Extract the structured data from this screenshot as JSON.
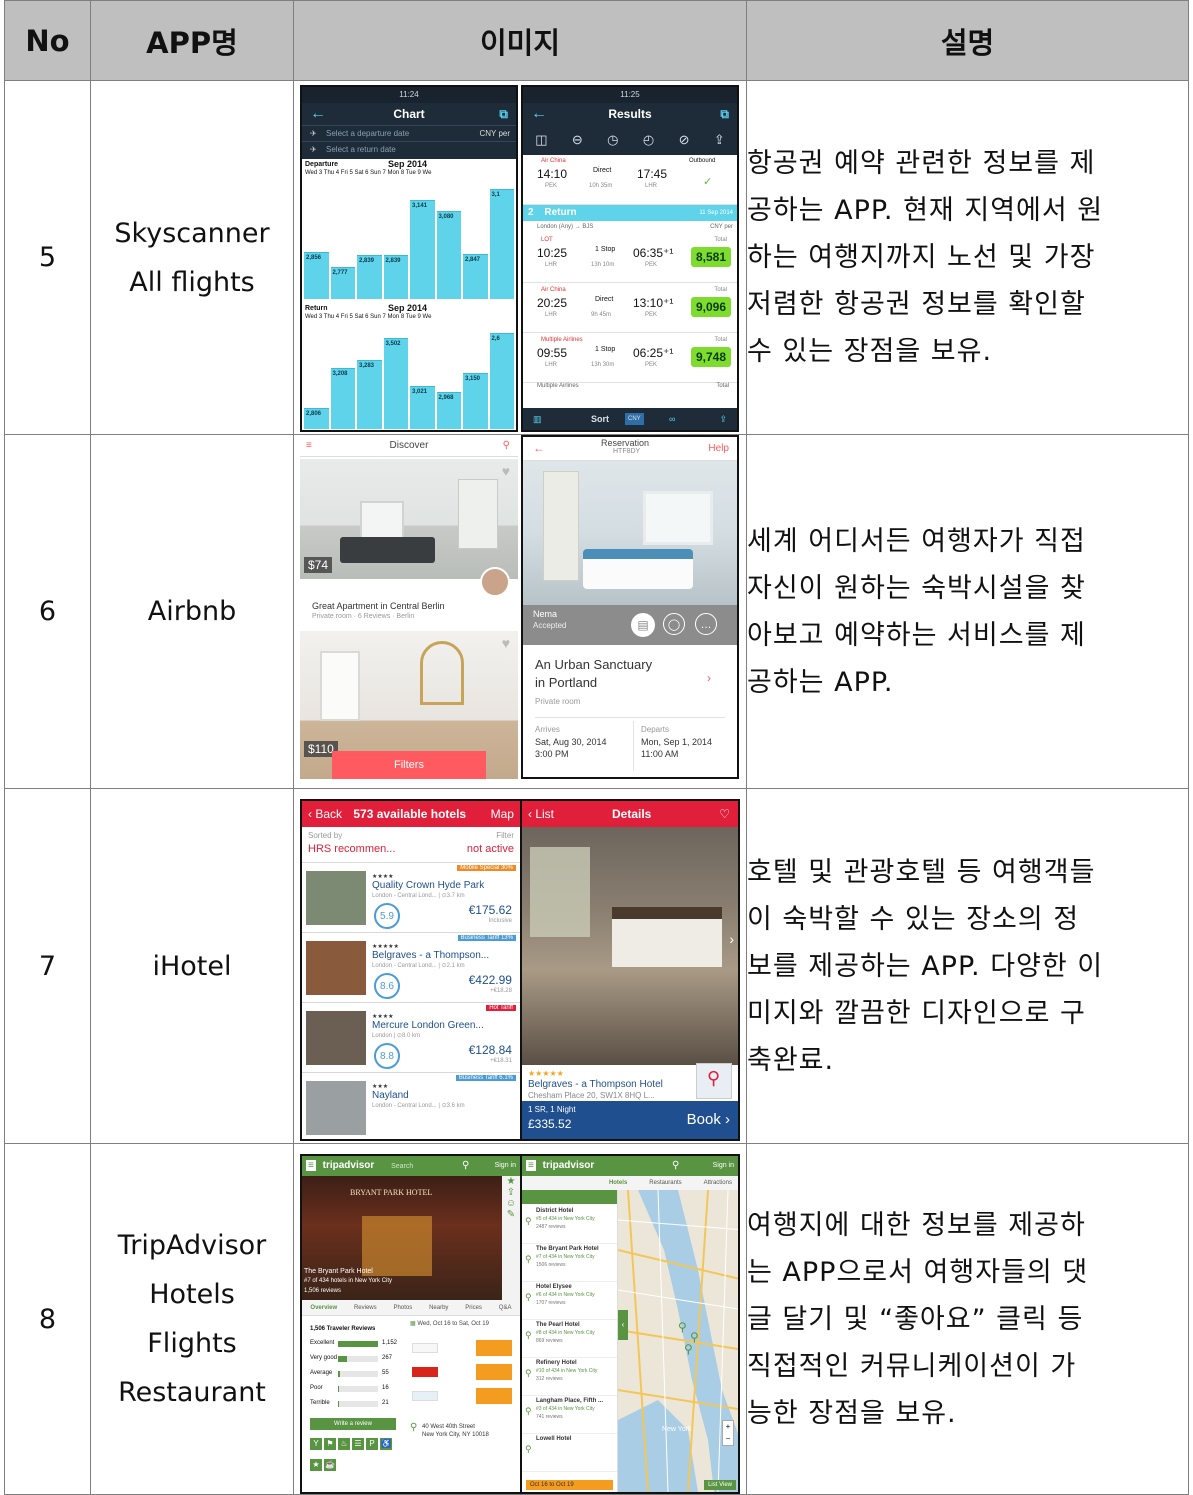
{
  "header": {
    "no": "No",
    "app": "APP명",
    "image": "이미지",
    "desc": "설명"
  },
  "rows": [
    {
      "no": "5",
      "app_lines": [
        "Skyscanner",
        "All flights"
      ],
      "desc_lines": [
        "항공권 예약 관련한 정보를 제",
        "공하는 APP. 현재 지역에서 원",
        "하는 여행지까지 노선 및 가장",
        "저렴한 항공권 정보를 확인할",
        "수 있는 장점을 보유."
      ],
      "left": {
        "status_time": "11:24",
        "title": "Chart",
        "sel1": "Select a departure date",
        "sel2": "Select a return date",
        "currency": "CNY per",
        "departure_label": "Departure",
        "departure_month": "Sep 2014",
        "days": "Wed 3  Thu 4  Fri 5  Sat 6  Sun 7  Mon 8  Tue 9  We",
        "return_label": "Return",
        "return_month": "Sep 2014",
        "bars_top": [
          "2,856",
          "2,777",
          "2,839",
          "2,839",
          "3,141",
          "3,080",
          "2,847",
          "3,1"
        ],
        "bars_bottom": [
          "2,806",
          "3,208",
          "3,283",
          "3,502",
          "3,021",
          "2,968",
          "3,150",
          "2,6"
        ]
      },
      "right": {
        "status_time": "11:25",
        "title": "Results",
        "outbound_airline": "Air China",
        "outbound_dep": "14:10",
        "outbound_dep_code": "PEK",
        "outbound_type": "Direct",
        "outbound_duration": "10h 35m",
        "outbound_arr": "17:45",
        "outbound_arr_code": "LHR",
        "outbound_tag": "Outbound",
        "return_num": "2",
        "return_label": "Return",
        "return_date": "11 Sep 2014",
        "route": "London (Any) → BJS",
        "currency": "CNY per",
        "flights": [
          {
            "airline": "LOT",
            "dep": "10:25",
            "dep_code": "LHR",
            "stops": "1 Stop",
            "dur": "13h 10m",
            "arr": "06:35⁺¹",
            "arr_code": "PEK",
            "total": "Total",
            "price": "8,581"
          },
          {
            "airline": "Air China",
            "dep": "20:25",
            "dep_code": "LHR",
            "stops": "Direct",
            "dur": "9h 45m",
            "arr": "13:10⁺¹",
            "arr_code": "PEK",
            "total": "Total",
            "price": "9,096"
          },
          {
            "airline": "Multiple Airlines",
            "dep": "09:55",
            "dep_code": "LHR",
            "stops": "1 Stop",
            "dur": "13h 30m",
            "arr": "06:25⁺¹",
            "arr_code": "PEK",
            "total": "Total",
            "price": "9,748"
          }
        ],
        "last_airline": "Multiple Airlines",
        "last_total": "Total",
        "sort": "Sort",
        "cny": "CNY"
      }
    },
    {
      "no": "6",
      "app_lines": [
        "Airbnb"
      ],
      "desc_lines": [
        "세계 어디서든 여행자가 직접",
        "자신이 원하는 숙박시설을 찾",
        "아보고 예약하는 서비스를 제",
        "공하는 APP."
      ],
      "left": {
        "title": "Discover",
        "price1": "$74",
        "listing_title": "Great Apartment in Central Berlin",
        "listing_sub": "Private room · 6 Reviews · Berlin",
        "price2": "$110",
        "filters": "Filters"
      },
      "right": {
        "title": "Reservation",
        "code": "HTF8DY",
        "help": "Help",
        "host": "Nema",
        "status": "Accepted",
        "listing_title1": "An Urban Sanctuary",
        "listing_title2": "in Portland",
        "listing_sub": "Private room",
        "arrives_label": "Arrives",
        "arrives_date": "Sat, Aug 30, 2014",
        "arrives_time": "3:00 PM",
        "departs_label": "Departs",
        "departs_date": "Mon, Sep 1, 2014",
        "departs_time": "11:00 AM"
      }
    },
    {
      "no": "7",
      "app_lines": [
        "iHotel"
      ],
      "desc_lines": [
        "호텔 및 관광호텔 등 여행객들",
        "이 숙박할 수 있는 장소의 정",
        "보를 제공하는 APP. 다양한 이",
        "미지와 깔끔한 디자인으로 구",
        "축완료."
      ],
      "left": {
        "back": "Back",
        "count": "573 available hotels",
        "map": "Map",
        "sorted_by": "Sorted by",
        "sort_value": "HRS recommen...",
        "filter": "Filter",
        "filter_value": "not active",
        "hotels": [
          {
            "badge": "Mobile Special 30%",
            "stars": "★★★★",
            "name": "Quality Crown Hyde Park",
            "loc": "London - Central Lond... | ⊙3.7 km",
            "score": "5.9",
            "price": "€175.62",
            "note": "Inclusive"
          },
          {
            "badge": "Business Tariff 13%",
            "stars": "★★★★★",
            "name": "Belgraves - a Thompson...",
            "loc": "London - Central Lond... | ⊙2.1 km",
            "score": "8.6",
            "price": "€422.99",
            "note": "+€18.28"
          },
          {
            "badge": "Hot Tariff",
            "stars": "★★★★",
            "name": "Mercure London Green...",
            "loc": "London | ⊙8.0 km",
            "score": "8.8",
            "price": "€128.84",
            "note": "+€18.31"
          },
          {
            "badge": "Business Tariff 6.1%",
            "stars": "★★★",
            "name": "Nayland",
            "loc": "London - Central Lond... | ⊙3.6 km",
            "score": "",
            "price": "",
            "note": ""
          }
        ]
      },
      "right": {
        "list": "List",
        "title": "Details",
        "stars": "★★★★★",
        "hotel_name": "Belgraves - a Thompson Hotel",
        "address": "Chesham Place 20, SW1X 8HQ L...",
        "night": "1 SR, 1 Night",
        "price": "£335.52",
        "book": "Book ›"
      }
    },
    {
      "no": "8",
      "app_lines": [
        "TripAdvisor",
        "Hotels",
        "Flights",
        "Restaurant"
      ],
      "desc_lines": [
        "여행지에 대한 정보를 제공하",
        "는 APP으로서 여행자들의 댓",
        "글 달기 및 “좋아요” 클릭 등",
        "직접적인 커뮤니케이션이 가",
        "능한 장점을 보유."
      ],
      "left": {
        "brand": "tripadvisor",
        "search": "Search",
        "signin": "Sign in",
        "sign_text": "BRYANT PARK HOTEL",
        "hotel": "The Bryant Park Hotel",
        "rank": "#7 of 434 hotels in New York City",
        "reviews": "1,506 reviews",
        "tabs": [
          "Overview",
          "Reviews",
          "Photos",
          "Nearby",
          "Prices",
          "Q&A"
        ],
        "traveler": "1,506 Traveler Reviews",
        "dates": "Wed, Oct 16 to Sat, Oct 19",
        "ratings": [
          "Excellent",
          "Very good",
          "Average",
          "Poor",
          "Terrible"
        ],
        "counts": [
          "1,152",
          "267",
          "55",
          "16",
          "21"
        ],
        "write": "Write a review",
        "address": "40 West 40th Street",
        "city": "New York City, NY 10018"
      },
      "right": {
        "brand": "tripadvisor",
        "signin": "Sign in",
        "tabs": [
          "Hotels",
          "Restaurants",
          "Attractions"
        ],
        "hotels": [
          {
            "name": "District Hotel",
            "rank": "#5 of 434 in New York City",
            "reviews": "2487 reviews"
          },
          {
            "name": "The Bryant Park Hotel",
            "rank": "#7 of 434 in New York City",
            "reviews": "1506 reviews"
          },
          {
            "name": "Hotel Elysee",
            "rank": "#6 of 434 in New York City",
            "reviews": "1707 reviews"
          },
          {
            "name": "The Pearl Hotel",
            "rank": "#8 of 434 in New York City",
            "reviews": "869 reviews"
          },
          {
            "name": "Refinery Hotel",
            "rank": "#10 of 434 in New York City",
            "reviews": "312 reviews"
          },
          {
            "name": "Langham Place, Fifth ...",
            "rank": "#3 of 434 in New York City",
            "reviews": "741 reviews"
          },
          {
            "name": "Lowell Hotel",
            "rank": "",
            "reviews": ""
          }
        ],
        "city_label": "New York",
        "footer_dates": "Oct 16 to Oct 19",
        "list_view": "List View"
      }
    }
  ],
  "colors": {
    "header_bg": "#bfbfbf",
    "sky_dark": "#1e2b38",
    "sky_bar": "#5fd3ea",
    "sky_price": "#7ddc2e",
    "airbnb_pink": "#ff5a5f",
    "ihotel_red": "#e21f3a",
    "ihotel_blue": "#1f4f8f",
    "tripadvisor_green": "#589442"
  }
}
